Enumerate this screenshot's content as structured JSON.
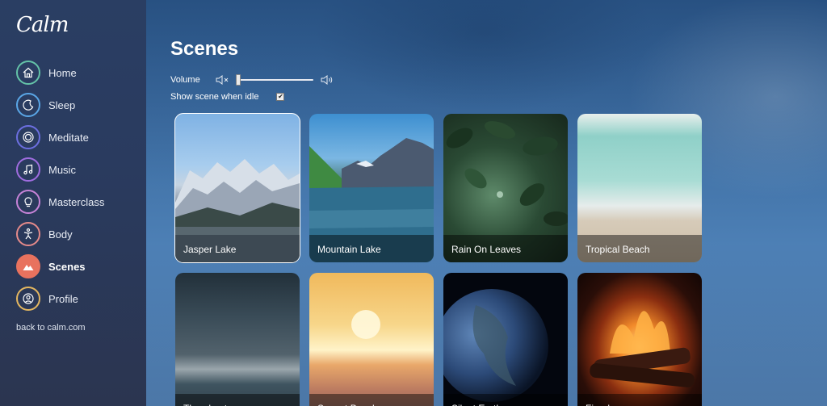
{
  "app": {
    "logo": "Calm"
  },
  "sidebar": {
    "items": [
      {
        "label": "Home",
        "icon": "home-icon",
        "color": "#64c3a8"
      },
      {
        "label": "Sleep",
        "icon": "moon-icon",
        "color": "#5aa6e6"
      },
      {
        "label": "Meditate",
        "icon": "target-icon",
        "color": "#6c6fe0"
      },
      {
        "label": "Music",
        "icon": "music-note-icon",
        "color": "#a06de0"
      },
      {
        "label": "Masterclass",
        "icon": "lightbulb-icon",
        "color": "#c783d8"
      },
      {
        "label": "Body",
        "icon": "body-icon",
        "color": "#e58a8a"
      },
      {
        "label": "Scenes",
        "icon": "mountain-icon",
        "color": "#e8725e",
        "active": true
      },
      {
        "label": "Profile",
        "icon": "profile-icon",
        "color": "#e4b760"
      }
    ],
    "back_link": "back to calm.com"
  },
  "page": {
    "title": "Scenes",
    "volume_label": "Volume",
    "volume_value": 0,
    "idle_label": "Show scene when idle",
    "idle_checked": true
  },
  "scenes": [
    {
      "label": "Jasper Lake",
      "selected": true
    },
    {
      "label": "Mountain Lake"
    },
    {
      "label": "Rain On Leaves"
    },
    {
      "label": "Tropical Beach"
    },
    {
      "label": "Thunderstorm"
    },
    {
      "label": "Sunset Beach"
    },
    {
      "label": "Silent Earth"
    },
    {
      "label": "Fireplace"
    }
  ]
}
